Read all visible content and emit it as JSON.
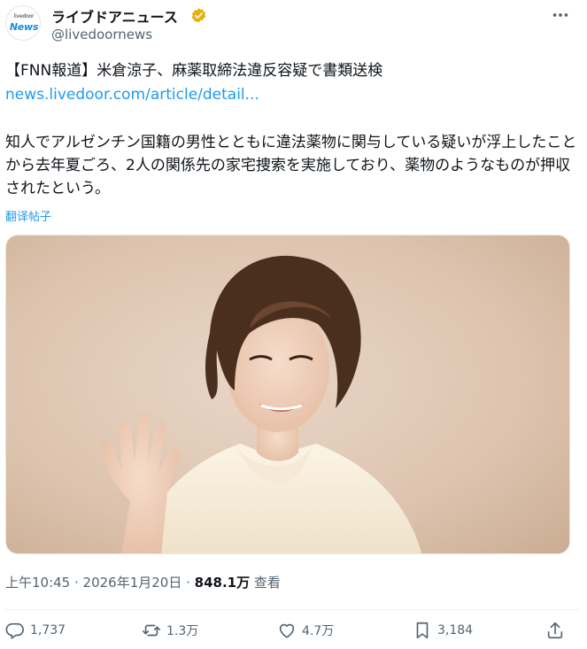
{
  "account": {
    "avatar_line1": "livedoor",
    "avatar_line2": "News",
    "display_name": "ライブドアニュース",
    "handle": "@livedoornews"
  },
  "post": {
    "headline": "【FNN報道】米倉涼子、麻薬取締法違反容疑で書類送検",
    "link": "news.livedoor.com/article/detail...",
    "paragraph": "知人でアルゼンチン国籍の男性とともに違法薬物に関与している疑いが浮上したことから去年夏ごろ、2人の関係先の家宅捜索を実施しており、薬物のようなものが押収されたという。",
    "translate_label": "翻译帖子"
  },
  "meta": {
    "time": "上午10:45",
    "separator": " · ",
    "date": "2026年1月20日",
    "views_count": "848.1万",
    "views_label": " 查看"
  },
  "actions": {
    "replies": "1,737",
    "reposts": "1.3万",
    "likes": "4.7万",
    "bookmarks": "3,184"
  },
  "colors": {
    "accent": "#1d9bf0",
    "verified": "#e8b00a",
    "muted": "#536471"
  },
  "icons": [
    "verified-badge-icon",
    "more-icon",
    "reply-icon",
    "repost-icon",
    "like-icon",
    "bookmark-icon",
    "share-icon"
  ]
}
